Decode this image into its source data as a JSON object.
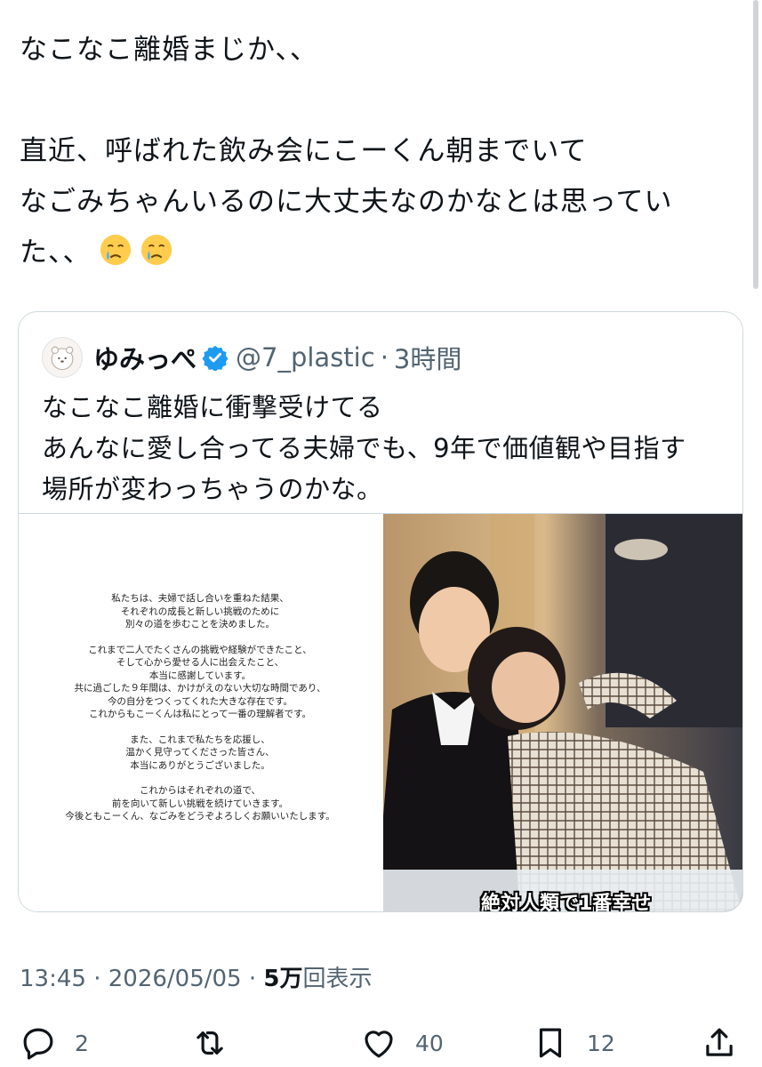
{
  "tweet": {
    "lines": [
      "なこなこ離婚まじか、、",
      "",
      "直近、呼ばれた飲み会にこーくん朝までいて",
      "なごみちゃんいるのに大丈夫なのかなとは思っていた、、"
    ],
    "emojis": [
      "crying-face",
      "crying-face"
    ]
  },
  "quote": {
    "name": "ゆみっぺ",
    "handle": "@7_plastic",
    "separator": "·",
    "time": "3時間",
    "text": [
      "なこなこ離婚に衝撃受けてる",
      "あんなに愛し合ってる夫婦でも、9年で価値観や目指す",
      "場所が変わっちゃうのかな。"
    ],
    "statement": [
      "私たちは、夫婦で話し合いを重ねた結果、",
      "それぞれの成長と新しい挑戦のために",
      "別々の道を歩むことを決めました。",
      "",
      "これまで二人でたくさんの挑戦や経験ができたこと、",
      "そして心から愛せる人に出会えたこと、",
      "本当に感謝しています。",
      "共に過ごした９年間は、かけがえのない大切な時間であり、",
      "今の自分をつくってくれた大きな存在です。",
      "これからもこーくんは私にとって一番の理解者です。",
      "",
      "また、これまで私たちを応援し、",
      "温かく見守ってくださった皆さん、",
      "本当にありがとうございました。",
      "",
      "これからはそれぞれの道で、",
      "前を向いて新しい挑戦を続けていきます。",
      "今後ともこーくん、なごみをどうぞよろしくお願いいたします。"
    ],
    "photo_caption": "絶対人類で1番幸せ"
  },
  "meta": {
    "time": "13:45",
    "date": "2026/05/05",
    "views_count": "5万",
    "views_label": "回表示",
    "separator": "·"
  },
  "actions": {
    "replies": "2",
    "reposts": "",
    "likes": "40",
    "bookmarks": "12"
  },
  "colors": {
    "text": "#0f1419",
    "secondary": "#536471",
    "verified": "#1d9bf0",
    "border": "#cfd9de"
  }
}
